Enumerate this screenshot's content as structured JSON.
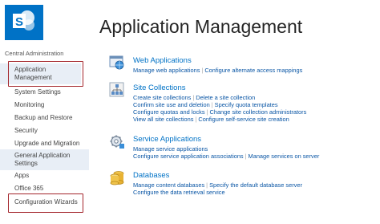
{
  "header": {
    "logo_icon": "sharepoint-logo-icon",
    "title": "Application Management"
  },
  "sidebar": {
    "heading": "Central Administration",
    "items": [
      {
        "label": "Application Management"
      },
      {
        "label": "System Settings"
      },
      {
        "label": "Monitoring"
      },
      {
        "label": "Backup and Restore"
      },
      {
        "label": "Security"
      },
      {
        "label": "Upgrade and Migration"
      },
      {
        "label": "General Application Settings"
      },
      {
        "label": "Apps"
      },
      {
        "label": "Office 365"
      },
      {
        "label": "Configuration Wizards"
      }
    ]
  },
  "sections": [
    {
      "icon": "web-applications-icon",
      "title": "Web Applications",
      "rows": [
        [
          "Manage web applications",
          "Configure alternate access mappings"
        ]
      ]
    },
    {
      "icon": "site-collections-icon",
      "title": "Site Collections",
      "rows": [
        [
          "Create site collections",
          "Delete a site collection"
        ],
        [
          "Confirm site use and deletion",
          "Specify quota templates"
        ],
        [
          "Configure quotas and locks",
          "Change site collection administrators"
        ],
        [
          "View all site collections",
          "Configure self-service site creation"
        ]
      ]
    },
    {
      "icon": "service-applications-icon",
      "title": "Service Applications",
      "rows": [
        [
          "Manage service applications"
        ],
        [
          "Configure service application associations",
          "Manage services on server"
        ]
      ]
    },
    {
      "icon": "databases-icon",
      "title": "Databases",
      "rows": [
        [
          "Manage content databases",
          "Specify the default database server"
        ],
        [
          "Configure the data retrieval service"
        ]
      ]
    }
  ],
  "colors": {
    "accent": "#0072c6",
    "link": "#0a56a5",
    "highlight_box": "#a4262c"
  }
}
